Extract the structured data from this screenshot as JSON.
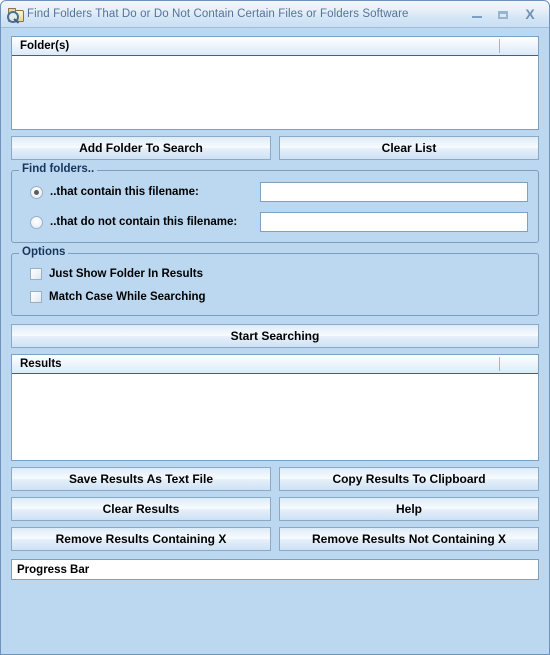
{
  "window": {
    "title": "Find Folders That Do or Do Not Contain Certain Files or Folders Software",
    "icon": "folder-magnifier-icon",
    "controls": {
      "minimize": "minimize-icon",
      "maximize": "maximize-icon",
      "close": "X"
    },
    "colors": {
      "background": "#bcd8f0",
      "border": "#6d93bd",
      "title_text": "#55739a",
      "group_title": "#16355c",
      "button_border": "#8aa9c6"
    }
  },
  "folders_list": {
    "header": "Folder(s)",
    "rows": []
  },
  "folder_buttons": {
    "add": "Add Folder To Search",
    "clear": "Clear List"
  },
  "find_folders_group": {
    "title": "Find folders..",
    "options": [
      {
        "label": "..that contain this filename:",
        "selected": true,
        "value": "",
        "placeholder": ""
      },
      {
        "label": "..that do not contain this filename:",
        "selected": false,
        "value": "",
        "placeholder": ""
      }
    ]
  },
  "options_group": {
    "title": "Options",
    "checkboxes": [
      {
        "label": "Just Show Folder In Results",
        "checked": false
      },
      {
        "label": "Match Case While Searching",
        "checked": false
      }
    ]
  },
  "start_button": {
    "label": "Start Searching"
  },
  "results_list": {
    "header": "Results",
    "rows": []
  },
  "result_buttons": {
    "save": "Save Results As Text File",
    "copy": "Copy Results To Clipboard",
    "clear": "Clear Results",
    "help": "Help",
    "remove_containing": "Remove Results Containing X",
    "remove_not_containing": "Remove Results Not Containing X"
  },
  "progress_bar": {
    "label": "Progress Bar",
    "percent": 0
  }
}
